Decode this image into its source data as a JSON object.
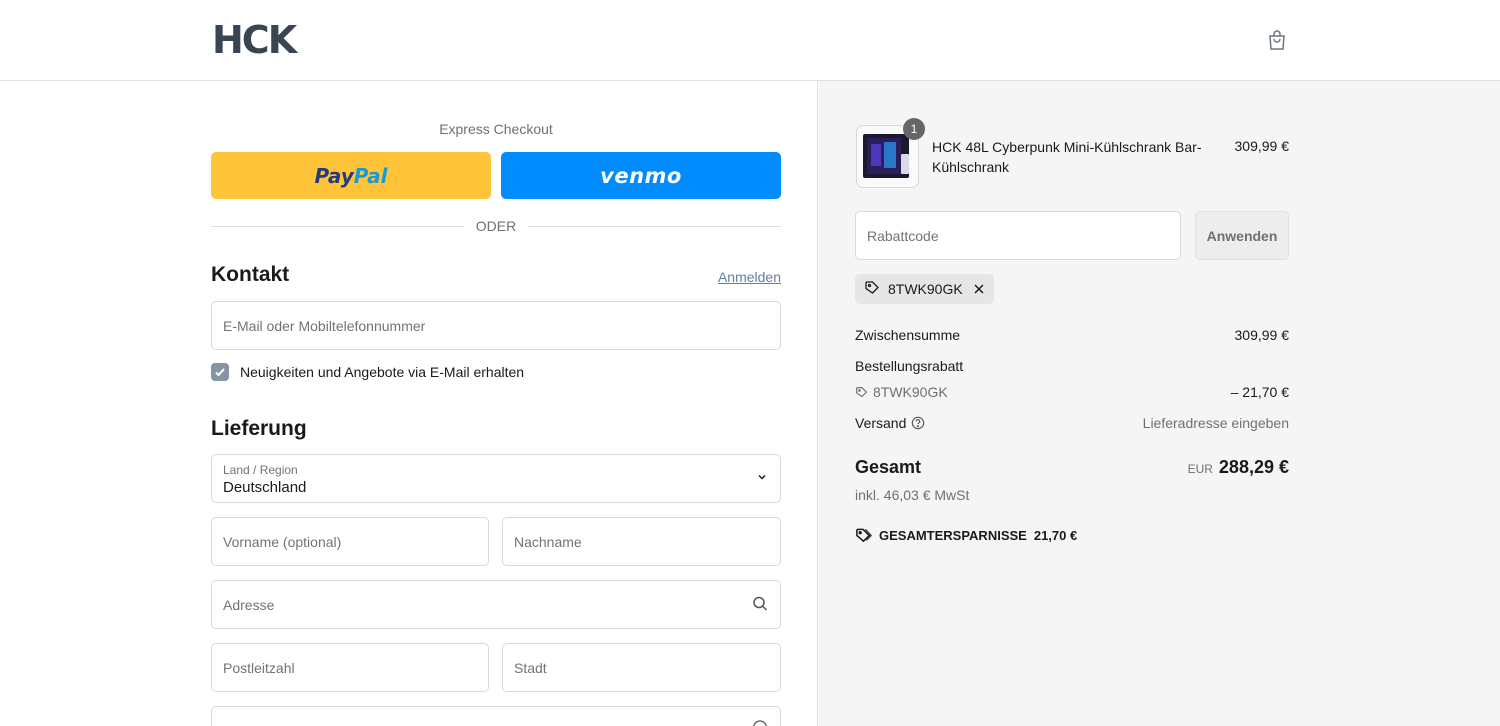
{
  "header": {
    "logo_text": "HCK",
    "cart_icon": "shopping-bag-icon"
  },
  "express": {
    "title": "Express Checkout",
    "paypal_part1": "Pay",
    "paypal_part2": "Pal",
    "venmo_label": "venmo",
    "divider": "ODER"
  },
  "contact": {
    "title": "Kontakt",
    "login_link": "Anmelden",
    "email_placeholder": "E-Mail oder Mobiltelefonnummer",
    "newsletter_label": "Neuigkeiten und Angebote via E-Mail erhalten",
    "newsletter_checked": true
  },
  "delivery": {
    "title": "Lieferung",
    "country_label": "Land / Region",
    "country_value": "Deutschland",
    "first_name_placeholder": "Vorname (optional)",
    "last_name_placeholder": "Nachname",
    "address_placeholder": "Adresse",
    "zip_placeholder": "Postleitzahl",
    "city_placeholder": "Stadt"
  },
  "summary": {
    "product": {
      "quantity": "1",
      "name": "HCK 48L Cyberpunk Mini-Kühlschrank Bar-Kühlschrank",
      "price": "309,99 €"
    },
    "discount_placeholder": "Rabattcode",
    "apply_label": "Anwenden",
    "applied_code": "8TWK90GK",
    "subtotal_label": "Zwischensumme",
    "subtotal_value": "309,99 €",
    "order_discount_label": "Bestellungsrabatt",
    "order_discount_code": "8TWK90GK",
    "order_discount_value": "– 21,70 €",
    "shipping_label": "Versand",
    "shipping_value": "Lieferadresse eingeben",
    "total_label": "Gesamt",
    "total_currency": "EUR",
    "total_value": "288,29 €",
    "tax_note": "inkl. 46,03 € MwSt",
    "savings_label": "GESAMTERSPARNISSE",
    "savings_value": "21,70 €"
  },
  "colors": {
    "paypal": "#ffc439",
    "venmo": "#008cff",
    "link": "#5f7fa6",
    "checkbox": "#8595a6"
  }
}
